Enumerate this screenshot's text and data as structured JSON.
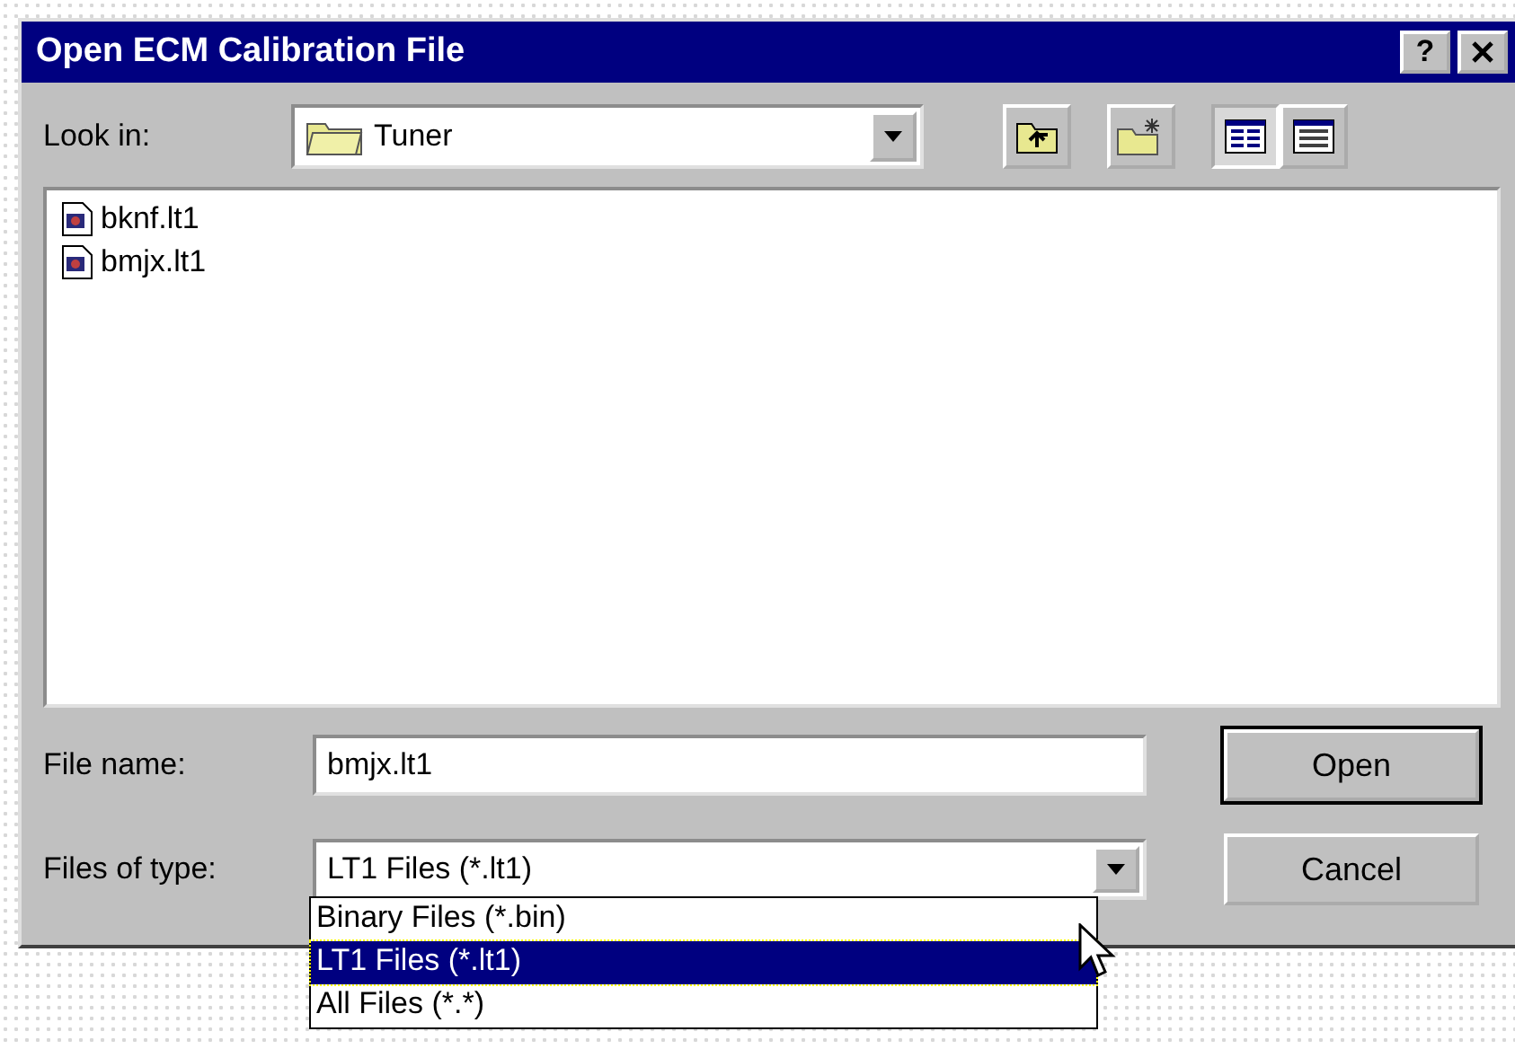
{
  "window": {
    "title": "Open ECM Calibration File",
    "help": "?"
  },
  "look_in": {
    "label": "Look in:",
    "value": "Tuner"
  },
  "view_buttons": [
    {
      "kind": "list",
      "selected": true
    },
    {
      "kind": "details",
      "selected": false
    }
  ],
  "files": [
    {
      "name": "bknf.lt1",
      "selected": false
    },
    {
      "name": "bmjx.lt1",
      "selected": false
    }
  ],
  "file_name": {
    "label": "File name:",
    "value": "bmjx.lt1"
  },
  "file_type": {
    "label": "Files of type:",
    "value": "LT1 Files (*.lt1)",
    "expanded": true,
    "options": [
      {
        "label": "Binary Files (*.bin)",
        "selected": false
      },
      {
        "label": "LT1 Files (*.lt1)",
        "selected": true
      },
      {
        "label": "All Files (*.*)",
        "selected": false
      }
    ]
  },
  "buttons": [
    {
      "label": "Open",
      "default": true
    },
    {
      "label": "Cancel",
      "default": false
    }
  ]
}
